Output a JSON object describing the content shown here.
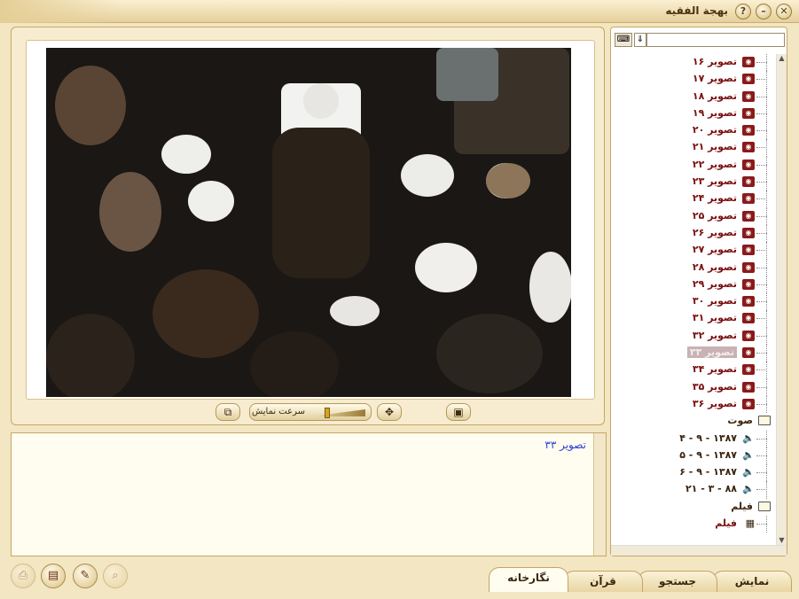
{
  "window": {
    "title": "بهجة الفقيه"
  },
  "titlebar_buttons": [
    {
      "name": "help-icon",
      "glyph": "?"
    },
    {
      "name": "minimize-icon",
      "glyph": "–"
    },
    {
      "name": "close-icon",
      "glyph": "✕"
    }
  ],
  "viewer": {
    "speed_label": "سرعت نمایش",
    "caption": "تصویر ۳۳"
  },
  "tree": {
    "search_placeholder": "",
    "images": [
      {
        "label": "تصویر ۱۶"
      },
      {
        "label": "تصویر ۱۷"
      },
      {
        "label": "تصویر ۱۸"
      },
      {
        "label": "تصویر ۱۹"
      },
      {
        "label": "تصویر ۲۰"
      },
      {
        "label": "تصویر ۲۱"
      },
      {
        "label": "تصویر ۲۲"
      },
      {
        "label": "تصویر ۲۳"
      },
      {
        "label": "تصویر ۲۴"
      },
      {
        "label": "تصویر ۲۵"
      },
      {
        "label": "تصویر ۲۶"
      },
      {
        "label": "تصویر ۲۷"
      },
      {
        "label": "تصویر ۲۸"
      },
      {
        "label": "تصویر ۲۹"
      },
      {
        "label": "تصویر ۳۰"
      },
      {
        "label": "تصویر ۳۱"
      },
      {
        "label": "تصویر ۳۲"
      },
      {
        "label": "تصویر ۳۳",
        "selected": true
      },
      {
        "label": "تصویر ۳۴"
      },
      {
        "label": "تصویر ۳۵"
      },
      {
        "label": "تصویر ۳۶"
      }
    ],
    "audio_folder": "صوت",
    "audio": [
      {
        "label": "۱۳۸۷ - ۹ - ۴"
      },
      {
        "label": "۱۳۸۷ - ۹ - ۵"
      },
      {
        "label": "۱۳۸۷ - ۹ - ۶"
      },
      {
        "label": "۸۸ - ۳ - ۲۱"
      }
    ],
    "video_folder": "فیلم",
    "video": [
      {
        "label": "فیلم"
      }
    ]
  },
  "tabs": [
    {
      "label": "نمایش"
    },
    {
      "label": "جستجو"
    },
    {
      "label": "قرآن"
    },
    {
      "label": "نگارخانه",
      "active": true
    }
  ]
}
